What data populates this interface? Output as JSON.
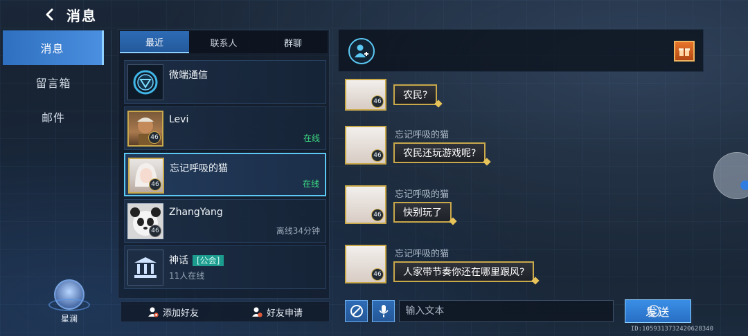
{
  "header": {
    "title": "消息"
  },
  "nav": {
    "items": [
      {
        "label": "消息",
        "active": true
      },
      {
        "label": "留言箱",
        "active": false
      },
      {
        "label": "邮件",
        "active": false
      }
    ]
  },
  "player": {
    "name": "星澜"
  },
  "tabs": [
    {
      "label": "最近",
      "active": true
    },
    {
      "label": "联系人",
      "active": false
    },
    {
      "label": "群聊",
      "active": false
    }
  ],
  "conversations": [
    {
      "name": "微端通信",
      "status": "",
      "level": "",
      "type": "system"
    },
    {
      "name": "Levi",
      "status": "在线",
      "level": "46",
      "type": "friend"
    },
    {
      "name": "忘记呼吸的猫",
      "status": "在线",
      "level": "46",
      "type": "friend",
      "selected": true
    },
    {
      "name": "ZhangYang",
      "status": "离线34分钟",
      "level": "46",
      "type": "friend"
    },
    {
      "name": "神话",
      "tag": "[公会]",
      "sub": "11人在线",
      "type": "guild"
    }
  ],
  "list_footer": {
    "add_friend": "添加好友",
    "friend_requests": "好友申请"
  },
  "chat": {
    "messages": [
      {
        "sender": "",
        "text": "农民?",
        "level": "46"
      },
      {
        "sender": "忘记呼吸的猫",
        "text": "农民还玩游戏呢?",
        "level": "46"
      },
      {
        "sender": "忘记呼吸的猫",
        "text": "快别玩了",
        "level": "46"
      },
      {
        "sender": "忘记呼吸的猫",
        "text": "人家带节奏你还在哪里跟风?",
        "level": "46"
      }
    ],
    "input_placeholder": "输入文本",
    "send_label": "发送"
  },
  "user_id": "ID:1059313732420628340",
  "colors": {
    "accent": "#3b8ee6",
    "online": "#3ddc84",
    "gold_frame": "#c9a94a",
    "guild_tag": "#1b9c8f"
  },
  "icons": {
    "back": "chevron-left-icon",
    "add_friend": "add-user-icon",
    "gift": "gift-icon",
    "voice": "microphone-icon",
    "emoji": "emoji-icon"
  }
}
